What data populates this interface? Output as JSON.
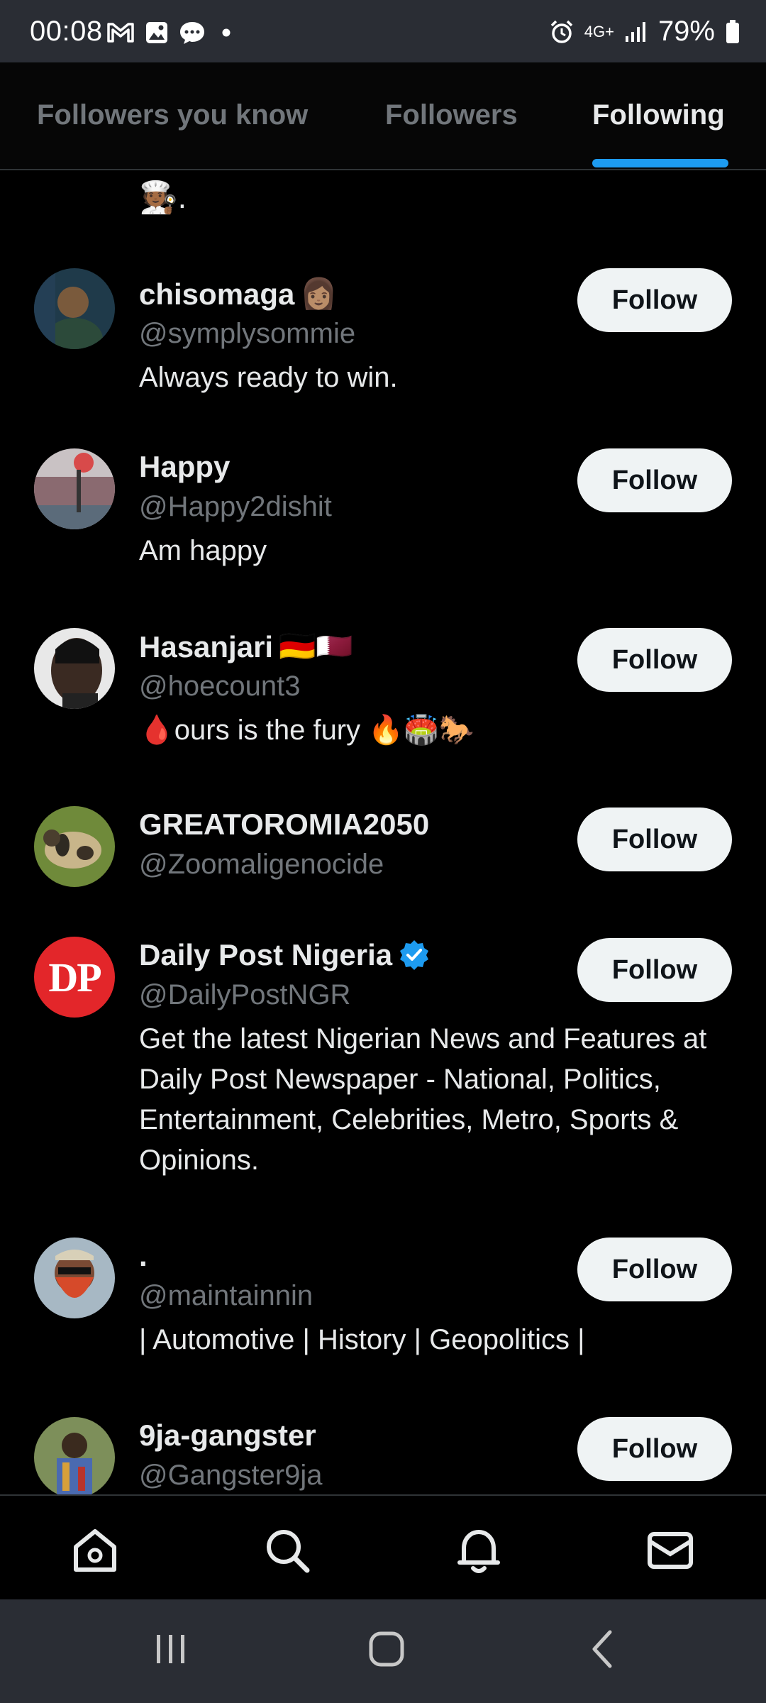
{
  "status_bar": {
    "time": "00:08",
    "network": "4G+",
    "battery": "79%"
  },
  "tabs": [
    {
      "label": "Followers you know"
    },
    {
      "label": "Followers"
    },
    {
      "label": "Following"
    }
  ],
  "trailing_bio": "🧑🏾‍🍳.",
  "users": [
    {
      "name": "chisomaga",
      "name_emoji": "👩🏽",
      "handle": "@symplysommie",
      "bio": "Always ready to win.",
      "button": "Follow"
    },
    {
      "name": "Happy",
      "handle": "@Happy2dishit",
      "bio": "Am happy",
      "button": "Follow"
    },
    {
      "name": "Hasanjari",
      "name_emoji": "🇩🇪🇶🇦",
      "handle": "@hoecount3",
      "bio": "🩸ours is the fury 🔥🏟️🐎",
      "button": "Follow"
    },
    {
      "name": "GREATOROMIA2050",
      "handle": "@Zoomaligenocide",
      "bio": "",
      "button": "Follow"
    },
    {
      "name": "Daily Post Nigeria",
      "handle": "@DailyPostNGR",
      "bio": "Get the latest Nigerian News and Features at Daily Post Newspaper - National, Politics, Entertainment, Celebrities, Metro, Sports & Opinions.",
      "button": "Follow",
      "avatar_text": "DP"
    },
    {
      "name": ".",
      "handle": "@maintainnin",
      "bio": "| Automotive | History | Geopolitics |",
      "button": "Follow"
    },
    {
      "name": "9ja-gangster",
      "handle": "@Gangster9ja",
      "bio": "",
      "button": "Follow"
    }
  ],
  "colors": {
    "accent": "#1d9bf0",
    "background": "#000000",
    "secondary_text": "#71767b",
    "button_bg": "#eff3f4"
  },
  "bottom_nav": [
    "home-icon",
    "search-icon",
    "notifications-icon",
    "messages-icon"
  ],
  "system_nav": [
    "recents-icon",
    "home-circle-icon",
    "back-icon"
  ]
}
